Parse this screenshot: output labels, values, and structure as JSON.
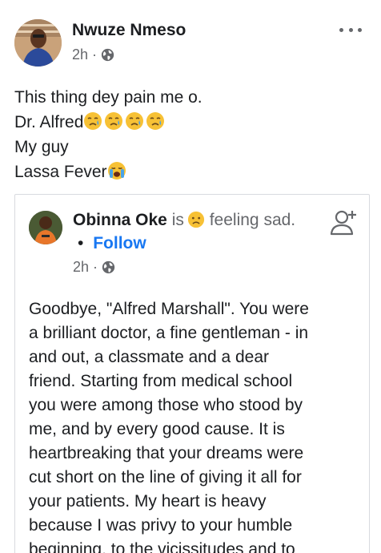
{
  "post": {
    "author": "Nwuze Nmeso",
    "time": "2h",
    "lines": {
      "l1": "This thing dey pain me o.",
      "l2": "Dr. Alfred",
      "l3": "My guy",
      "l4": "Lassa Fever"
    },
    "emoji_after_l2": "crying-sad-face x4",
    "emoji_after_l4": "loudly-crying-face"
  },
  "shared": {
    "author": "Obinna Oke",
    "is_word": "is",
    "feeling_word": "feeling",
    "feeling": "sad.",
    "dot": "•",
    "follow": "Follow",
    "time": "2h",
    "body": [
      "Goodbye, \"Alfred Marshall\". You were",
      "a brilliant doctor, a fine gentleman - in",
      "and out, a classmate and a dear",
      "friend. Starting from medical school",
      "you were among those who stood by",
      "me, and by every good cause. It is",
      "heartbreaking that your dreams were",
      "cut short on the line of giving it all for",
      "your patients. My heart is heavy",
      "because I was privy to your humble",
      "beginning, to the vicissitudes and to"
    ]
  },
  "colors": {
    "link_blue": "#1877f2",
    "meta_gray": "#65676b",
    "text_dark": "#1c1e21"
  }
}
